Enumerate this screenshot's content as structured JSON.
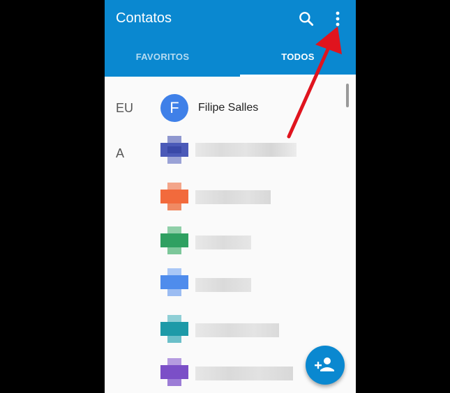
{
  "app": {
    "title": "Contatos"
  },
  "tabs": [
    {
      "label": "FAVORITOS",
      "selected": false
    },
    {
      "label": "TODOS",
      "selected": true
    }
  ],
  "sections": [
    {
      "letter": "EU",
      "contacts": [
        {
          "initial": "F",
          "name": "Filipe Salles"
        }
      ]
    },
    {
      "letter": "A"
    }
  ],
  "colors": {
    "app_bar": "#0a88d0",
    "avatar_me": "#3f80e8",
    "annotation_arrow": "#e0141e"
  },
  "icons": {
    "search": "search-icon",
    "more": "more-vert-icon",
    "add_contact": "person-add-icon"
  }
}
